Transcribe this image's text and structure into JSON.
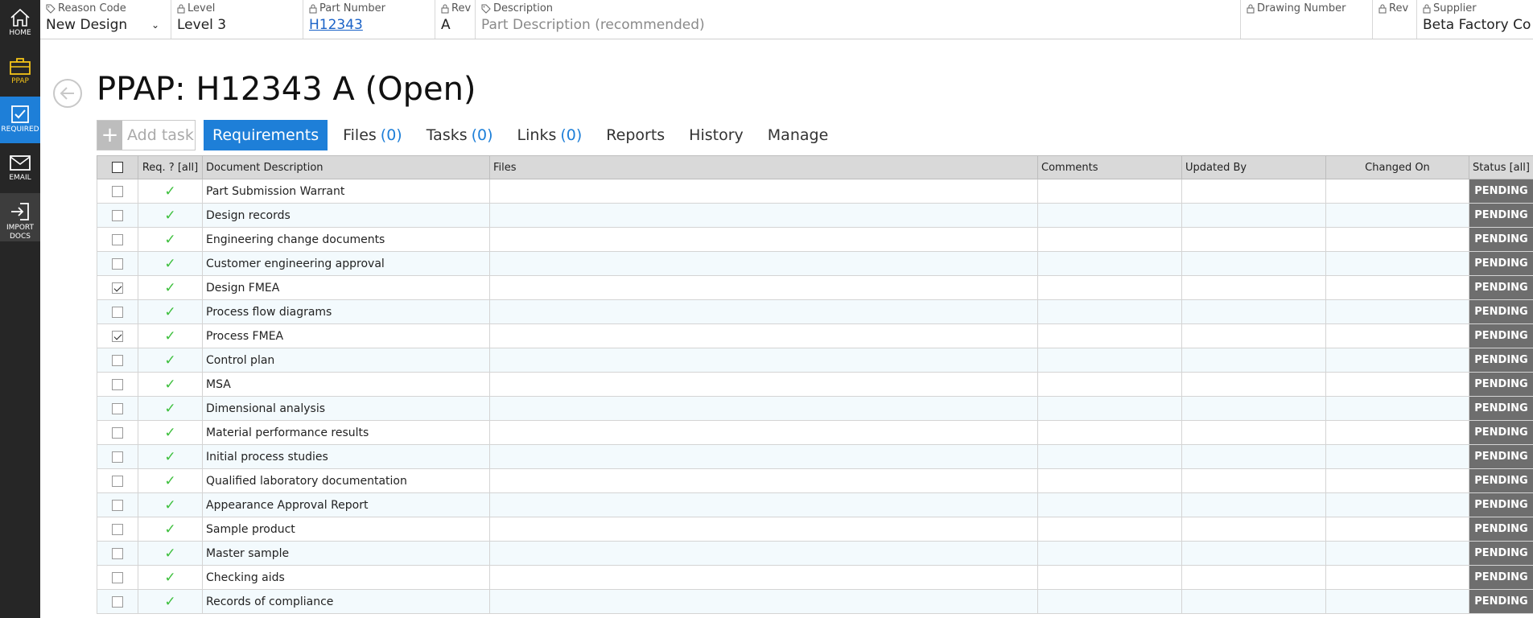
{
  "sidebar": {
    "items": [
      {
        "label": "HOME",
        "icon": "home-icon"
      },
      {
        "label": "PPAP",
        "icon": "briefcase-icon"
      },
      {
        "label": "REQUIRED",
        "icon": "checkbox-icon"
      },
      {
        "label": "EMAIL",
        "icon": "envelope-icon"
      },
      {
        "label_line1": "IMPORT",
        "label_line2": "DOCS",
        "icon": "import-icon"
      }
    ]
  },
  "header": {
    "reason_code": {
      "label": "Reason Code",
      "value": "New Design"
    },
    "level": {
      "label": "Level",
      "value": "Level 3"
    },
    "part_number": {
      "label": "Part Number",
      "value": "H12343"
    },
    "rev": {
      "label": "Rev",
      "value": "A"
    },
    "description": {
      "label": "Description",
      "placeholder": "Part Description (recommended)"
    },
    "drawing_number": {
      "label": "Drawing Number",
      "value": ""
    },
    "drawing_rev": {
      "label": "Rev",
      "value": ""
    },
    "supplier": {
      "label": "Supplier",
      "value": "Beta Factory Co"
    }
  },
  "page": {
    "title": "PPAP: H12343 A (Open)"
  },
  "toolbar": {
    "add_task_label": "Add task",
    "tabs": [
      {
        "label": "Requirements",
        "count": null
      },
      {
        "label": "Files",
        "count": "(0)"
      },
      {
        "label": "Tasks",
        "count": "(0)"
      },
      {
        "label": "Links",
        "count": "(0)"
      },
      {
        "label": "Reports",
        "count": null
      },
      {
        "label": "History",
        "count": null
      },
      {
        "label": "Manage",
        "count": null
      }
    ]
  },
  "table": {
    "headers": {
      "req": "Req. ? [all]",
      "description": "Document Description",
      "files": "Files",
      "comments": "Comments",
      "updated_by": "Updated By",
      "changed_on": "Changed On",
      "status": "Status [all]"
    },
    "rows": [
      {
        "checked": false,
        "description": "Part Submission Warrant",
        "status": "PENDING"
      },
      {
        "checked": false,
        "description": "Design records",
        "status": "PENDING"
      },
      {
        "checked": false,
        "description": "Engineering change documents",
        "status": "PENDING"
      },
      {
        "checked": false,
        "description": "Customer engineering approval",
        "status": "PENDING"
      },
      {
        "checked": true,
        "description": "Design FMEA",
        "status": "PENDING"
      },
      {
        "checked": false,
        "description": "Process flow diagrams",
        "status": "PENDING"
      },
      {
        "checked": true,
        "description": "Process FMEA",
        "status": "PENDING"
      },
      {
        "checked": false,
        "description": "Control plan",
        "status": "PENDING"
      },
      {
        "checked": false,
        "description": "MSA",
        "status": "PENDING"
      },
      {
        "checked": false,
        "description": "Dimensional analysis",
        "status": "PENDING"
      },
      {
        "checked": false,
        "description": "Material performance results",
        "status": "PENDING"
      },
      {
        "checked": false,
        "description": "Initial process studies",
        "status": "PENDING"
      },
      {
        "checked": false,
        "description": "Qualified laboratory documentation",
        "status": "PENDING"
      },
      {
        "checked": false,
        "description": "Appearance Approval Report",
        "status": "PENDING"
      },
      {
        "checked": false,
        "description": "Sample product",
        "status": "PENDING"
      },
      {
        "checked": false,
        "description": "Master sample",
        "status": "PENDING"
      },
      {
        "checked": false,
        "description": "Checking aids",
        "status": "PENDING"
      },
      {
        "checked": false,
        "description": "Records of compliance",
        "status": "PENDING"
      }
    ]
  },
  "colors": {
    "accent": "#1e7fd8",
    "sidebar": "#262626",
    "ppap": "#f5c518",
    "check": "#3cbf3c",
    "status_bg": "#6e6e6e"
  }
}
